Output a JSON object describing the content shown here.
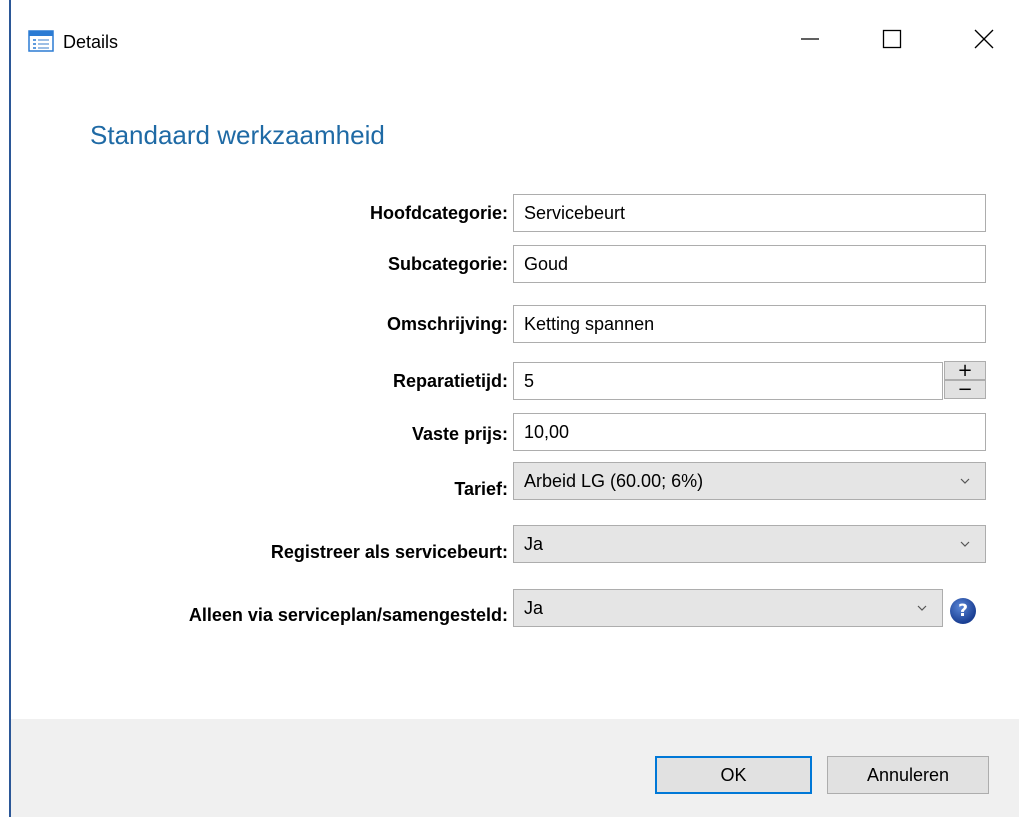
{
  "window": {
    "title": "Details"
  },
  "heading": "Standaard werkzaamheid",
  "form": {
    "hoofdcategorie": {
      "label": "Hoofdcategorie:",
      "value": "Servicebeurt"
    },
    "subcategorie": {
      "label": "Subcategorie:",
      "value": "Goud"
    },
    "omschrijving": {
      "label": "Omschrijving:",
      "value": "Ketting spannen"
    },
    "reparatietijd": {
      "label": "Reparatietijd:",
      "value": "5"
    },
    "vaste_prijs": {
      "label": "Vaste prijs:",
      "value": "10,00"
    },
    "tarief": {
      "label": "Tarief:",
      "value": "Arbeid LG (60.00; 6%)"
    },
    "registreer": {
      "label": "Registreer als servicebeurt:",
      "value": "Ja"
    },
    "alleen_via": {
      "label": "Alleen via serviceplan/samengesteld:",
      "value": "Ja"
    }
  },
  "stepper": {
    "plus": "+",
    "minus": "−"
  },
  "help": {
    "glyph": "?"
  },
  "buttons": {
    "ok": "OK",
    "cancel": "Annuleren"
  },
  "icons": {
    "app": "form-window-icon",
    "minimize": "minimize-icon",
    "maximize": "maximize-icon",
    "close": "close-icon",
    "dropdown": "chevron-down-icon",
    "help": "help-icon"
  },
  "colors": {
    "heading": "#1f6aa5",
    "window_border": "#2b5797",
    "ok_border": "#0078d7",
    "footer": "#f0f0f0",
    "select_bg": "#e5e5e5"
  }
}
